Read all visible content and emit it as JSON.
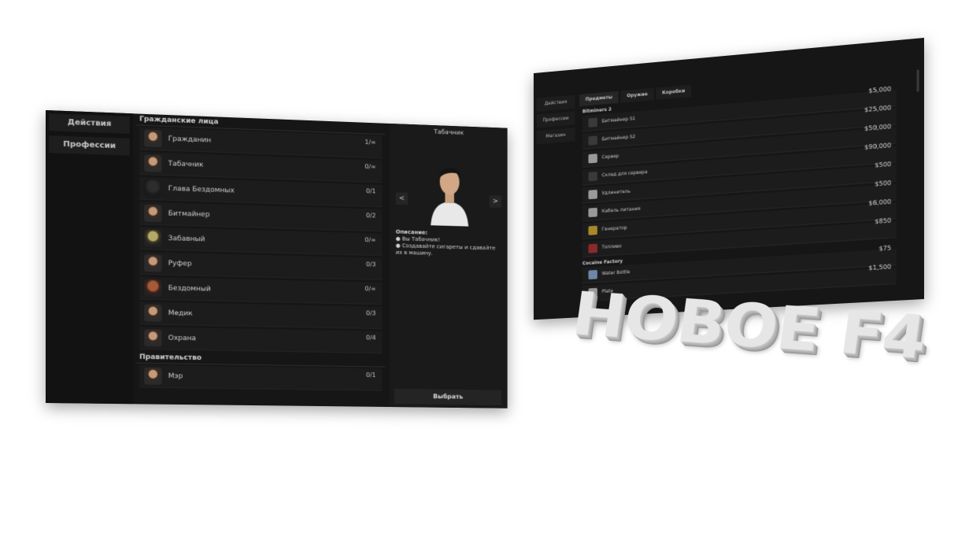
{
  "left_panel": {
    "sidebar": [
      {
        "label": "Действия"
      },
      {
        "label": "Профессии"
      }
    ],
    "categories": [
      {
        "name": "Гражданские лица",
        "jobs": [
          {
            "name": "Гражданин",
            "count": "1/∞",
            "avatar": "face"
          },
          {
            "name": "Табачник",
            "count": "0/∞",
            "avatar": "face"
          },
          {
            "name": "Глава Бездомных",
            "count": "0/1",
            "avatar": "dark"
          },
          {
            "name": "Битмайнер",
            "count": "0/2",
            "avatar": "face"
          },
          {
            "name": "Забавный",
            "count": "0/∞",
            "avatar": "zombie"
          },
          {
            "name": "Руфер",
            "count": "0/3",
            "avatar": "face"
          },
          {
            "name": "Бездомный",
            "count": "0/∞",
            "avatar": "red"
          },
          {
            "name": "Медик",
            "count": "0/3",
            "avatar": "face"
          },
          {
            "name": "Охрана",
            "count": "0/4",
            "avatar": "face"
          }
        ]
      },
      {
        "name": "Правительство",
        "jobs": [
          {
            "name": "Мэр",
            "count": "0/1",
            "avatar": "face"
          }
        ]
      }
    ],
    "detail": {
      "title": "Табачник",
      "prev_label": "<",
      "next_label": ">",
      "description_heading": "Описание:",
      "description_lines": [
        "● Вы Табачник!",
        "● Создавайте сигареты и сдавайте их в машину."
      ],
      "choose_label": "Выбрать"
    }
  },
  "right_panel": {
    "sidebar": [
      {
        "label": "Действия"
      },
      {
        "label": "Профессии"
      },
      {
        "label": "Магазин"
      }
    ],
    "tabs": [
      {
        "label": "Предметы",
        "active": true
      },
      {
        "label": "Оружие",
        "active": false
      },
      {
        "label": "Коробки",
        "active": false
      }
    ],
    "categories": [
      {
        "name": "Bitminers 2",
        "items": [
          {
            "name": "Битмайнер S1",
            "price": "$5,000",
            "icon": "dark"
          },
          {
            "name": "Битмайнер S2",
            "price": "$25,000",
            "icon": "dark"
          },
          {
            "name": "Сервер",
            "price": "$50,000",
            "icon": "light"
          },
          {
            "name": "Склад для сервера",
            "price": "$90,000",
            "icon": "dark"
          },
          {
            "name": "Удлинитель",
            "price": "$500",
            "icon": "light"
          },
          {
            "name": "Кабель питания",
            "price": "$500",
            "icon": "light"
          },
          {
            "name": "Генератор",
            "price": "$6,000",
            "icon": "yellow"
          },
          {
            "name": "Топливо",
            "price": "$850",
            "icon": "red"
          }
        ]
      },
      {
        "name": "Cocaine Factory",
        "items": [
          {
            "name": "Water Bottle",
            "price": "$75",
            "icon": "blue"
          },
          {
            "name": "Plate",
            "price": "$1,500",
            "icon": "light"
          }
        ]
      }
    ]
  },
  "title_text": "НОВОЕ F4"
}
